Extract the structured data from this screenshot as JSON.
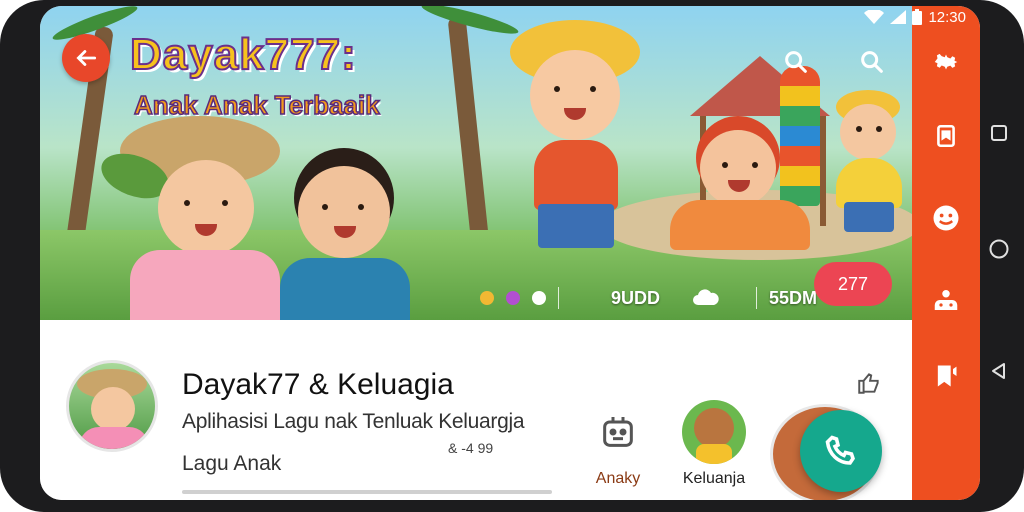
{
  "status_bar": {
    "time": "12:30"
  },
  "banner": {
    "title_line1": "Dayak777:",
    "title_line2": "Anak Anak Terbaaik",
    "stats": {
      "plays": "9UDD",
      "views": "55DM"
    },
    "count": "277"
  },
  "channel": {
    "title": "Dayak77 & Keluagia",
    "subtitle": "Aplihasisi Lagu nak Tenluak Keluargja",
    "meta": "& -4 99",
    "category": "Lagu Anak"
  },
  "chips": [
    {
      "label": "Anaky",
      "icon": "robot-icon"
    },
    {
      "label": "Keluanja",
      "icon": "bear-avatar"
    }
  ],
  "rail_icons": [
    "gear-icon",
    "bookmark-icon",
    "smiley-icon",
    "people-icon",
    "bookmark-flag-icon"
  ],
  "nav_icons": [
    "recent-apps-icon",
    "home-icon",
    "back-icon"
  ],
  "colors": {
    "accent": "#ee4f20",
    "fab": "#15a88d",
    "pill": "#ec4553"
  }
}
